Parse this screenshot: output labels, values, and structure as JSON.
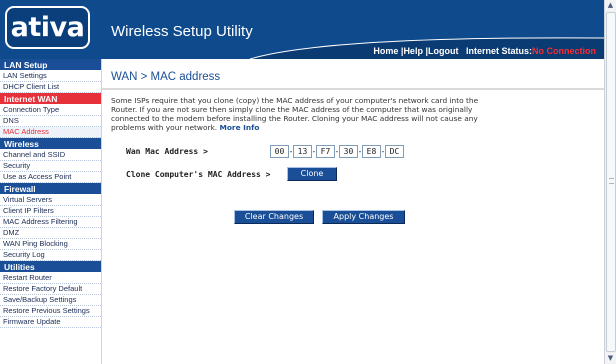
{
  "header": {
    "logo": "ativa",
    "logo_tm": "™",
    "app_title": "Wireless Setup Utility",
    "nav": {
      "home": "Home",
      "sep1": " |",
      "help": "Help",
      "sep2": " |",
      "logout": "Logout",
      "status_label": "   Internet Status:",
      "status_value": "No Connection"
    }
  },
  "sidebar": {
    "sections": [
      {
        "title": "LAN Setup",
        "items": [
          "LAN Settings",
          "DHCP Client List"
        ]
      },
      {
        "title": "Internet WAN",
        "items": [
          "Connection Type",
          "DNS",
          "MAC Address"
        ]
      },
      {
        "title": "Wireless",
        "items": [
          "Channel and SSID",
          "Security",
          "Use as Access Point"
        ]
      },
      {
        "title": "Firewall",
        "items": [
          "Virtual Servers",
          "Client IP Filters",
          "MAC Address Filtering",
          "DMZ",
          "WAN Ping Blocking",
          "Security Log"
        ]
      },
      {
        "title": "Utilities",
        "items": [
          "Restart Router",
          "Restore Factory Default",
          "Save/Backup Settings",
          "Restore Previous Settings",
          "Firmware Update"
        ]
      }
    ]
  },
  "main": {
    "title": "WAN > MAC address",
    "description": "Some ISPs require that you clone (copy) the MAC address of your computer's network card into the Router. If you are not sure then simply clone the MAC address of the computer that was originally connected to the modem before installing the Router. Cloning your MAC address will not cause any problems with your network.",
    "more_info": "More Info",
    "wan_mac_label": "Wan Mac Address >",
    "mac_octets": [
      "00",
      "13",
      "F7",
      "30",
      "E8",
      "DC"
    ],
    "mac_separator": "-",
    "clone_label": "Clone Computer's MAC Address >",
    "clone_button": "Clone",
    "clear_button": "Clear Changes",
    "apply_button": "Apply Changes"
  },
  "scrollbar": {
    "up_arrow": "▲",
    "down_arrow": "▼"
  },
  "colors": {
    "header_bg": "#0f4a8c",
    "section_bg": "#1a4f97",
    "active_section_bg": "#e6303a",
    "status_red": "#ff2a2a",
    "button_bg": "#1a4f97"
  }
}
